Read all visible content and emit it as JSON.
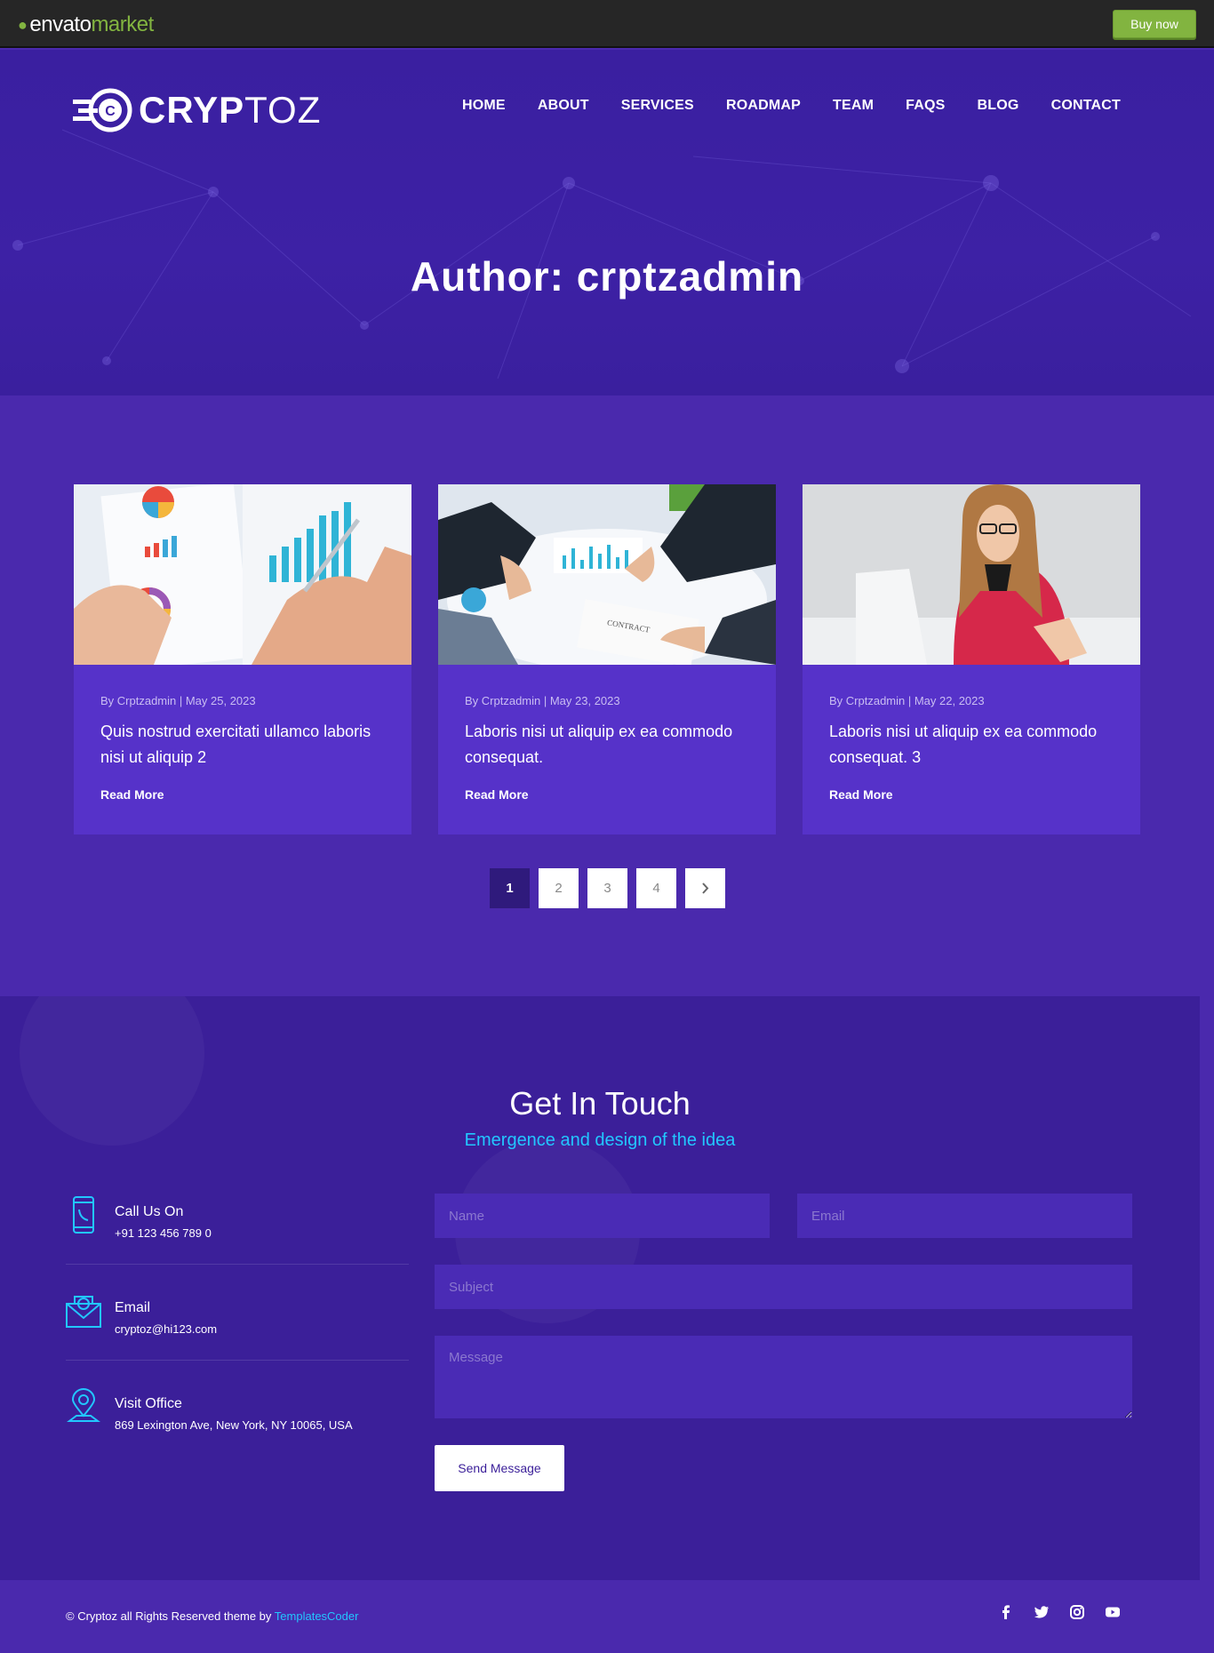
{
  "envato": {
    "brand_main": "envato",
    "brand_sub": "market",
    "buy_label": "Buy now"
  },
  "header": {
    "logo_bold": "CRYP",
    "logo_light": "TOZ",
    "nav": [
      "HOME",
      "ABOUT",
      "SERVICES",
      "ROADMAP",
      "TEAM",
      "FAQS",
      "BLOG",
      "CONTACT"
    ]
  },
  "hero": {
    "title": "Author: crptzadmin"
  },
  "posts": [
    {
      "meta": "By Crptzadmin | May 25, 2023",
      "title": "Quis nostrud exercitati ullamco laboris nisi ut aliquip 2",
      "read_more": "Read More"
    },
    {
      "meta": "By Crptzadmin | May 23, 2023",
      "title": "Laboris nisi ut aliquip ex ea commodo consequat.",
      "read_more": "Read More"
    },
    {
      "meta": "By Crptzadmin | May 22, 2023",
      "title": "Laboris nisi ut aliquip ex ea commodo consequat. 3",
      "read_more": "Read More"
    }
  ],
  "pagination": {
    "pages": [
      "1",
      "2",
      "3",
      "4"
    ],
    "current": "1",
    "next_icon": "chevron-right-icon"
  },
  "contact": {
    "heading": "Get In Touch",
    "subheading": "Emergence and design of the idea",
    "info": [
      {
        "label": "Call Us On",
        "value": "+91 123 456 789 0",
        "icon": "phone-icon"
      },
      {
        "label": "Email",
        "value": "cryptoz@hi123.com",
        "icon": "envelope-icon"
      },
      {
        "label": "Visit Office",
        "value": "869 Lexington Ave, New York, NY 10065, USA",
        "icon": "location-pin-icon"
      }
    ],
    "form": {
      "name_placeholder": "Name",
      "email_placeholder": "Email",
      "subject_placeholder": "Subject",
      "message_placeholder": "Message",
      "send_label": "Send Message"
    }
  },
  "footer": {
    "copyright": "© Cryptoz all Rights Reserved theme by",
    "credit": "TemplatesCoder",
    "social": [
      "facebook-icon",
      "twitter-icon",
      "instagram-icon",
      "youtube-icon"
    ]
  },
  "colors": {
    "accent_cyan": "#22c7ff",
    "envato_green": "#82b440",
    "card_bg": "#5632c9",
    "contact_bg": "#3b1f99"
  }
}
